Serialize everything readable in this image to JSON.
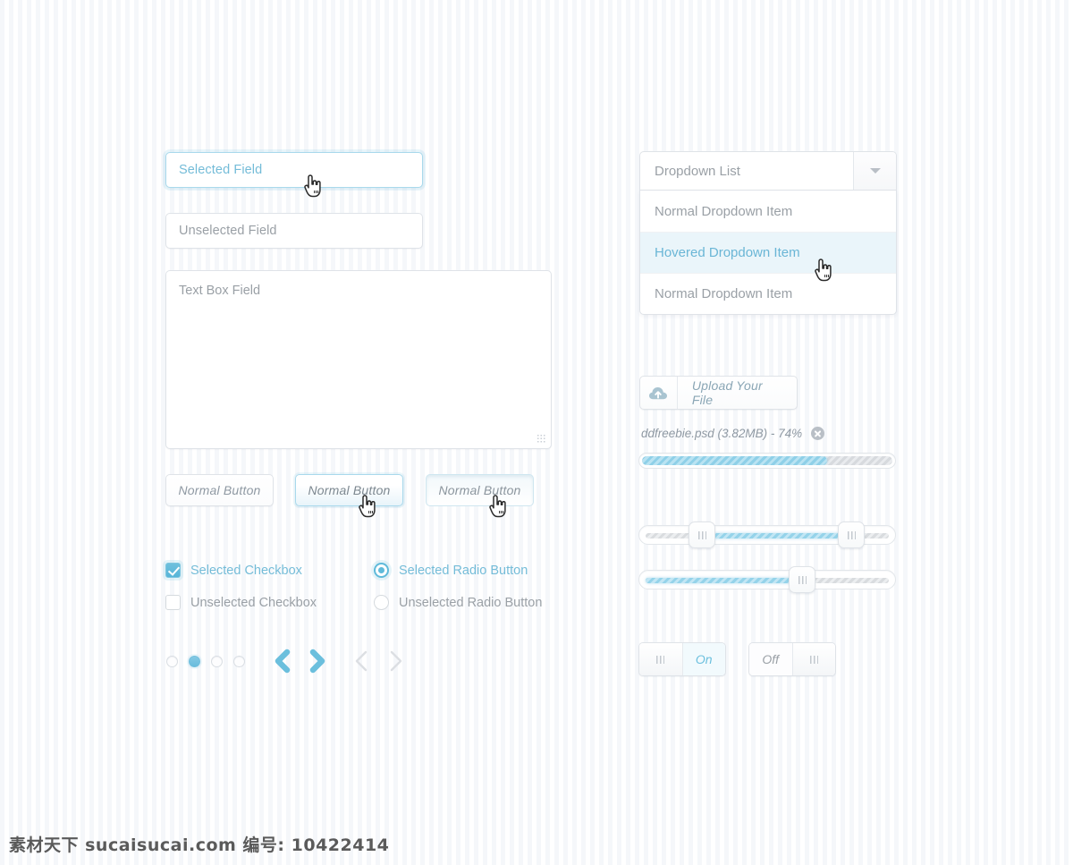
{
  "theme": {
    "accent": "#6cb7d4",
    "accent_fill": "#68bcdd",
    "muted_text": "#9aa0a6",
    "border": "#dfe3e8",
    "hover_bg": "#eaf5fa",
    "page_bg": "#ffffff",
    "stripe": "#f5f7fa"
  },
  "fields": {
    "selected": {
      "label": "Selected Field",
      "state": "selected"
    },
    "unselected": {
      "label": "Unselected Field",
      "state": "normal"
    },
    "textbox": {
      "label": "Text Box Field",
      "resize_icon": "resize-grip-icon"
    }
  },
  "buttons": [
    {
      "label": "Normal Button",
      "state": "normal"
    },
    {
      "label": "Normal Button",
      "state": "hovered"
    },
    {
      "label": "Normal Button",
      "state": "pressed"
    }
  ],
  "checkboxes": [
    {
      "label": "Selected Checkbox",
      "checked": true
    },
    {
      "label": "Unselected Checkbox",
      "checked": false
    }
  ],
  "radios": [
    {
      "label": "Selected Radio Button",
      "checked": true
    },
    {
      "label": "Unselected Radio Button",
      "checked": false
    }
  ],
  "pagination": {
    "dots": [
      {
        "active": false
      },
      {
        "active": true
      },
      {
        "active": false
      },
      {
        "active": false
      }
    ],
    "arrows": [
      {
        "icon": "chevron-left-icon",
        "state": "active"
      },
      {
        "icon": "chevron-right-icon",
        "state": "active"
      },
      {
        "icon": "chevron-left-icon",
        "state": "disabled"
      },
      {
        "icon": "chevron-right-icon",
        "state": "disabled"
      }
    ]
  },
  "dropdown": {
    "value": "Dropdown List",
    "arrow_icon": "chevron-down-icon",
    "items": [
      {
        "label": "Normal Dropdown Item",
        "state": "normal"
      },
      {
        "label": "Hovered Dropdown Item",
        "state": "hovered"
      },
      {
        "label": "Normal Dropdown Item",
        "state": "normal"
      }
    ]
  },
  "upload": {
    "icon": "cloud-upload-icon",
    "button_label": "Upload Your File",
    "file_status": "ddfreebie.psd (3.82MB) - 74%",
    "remove_icon": "close-circle-icon",
    "progress_percent": 74
  },
  "sliders": [
    {
      "type": "range",
      "start_percent": 23,
      "end_percent": 84,
      "grip_icon": "grip-icon"
    },
    {
      "type": "single",
      "value_percent": 64,
      "grip_icon": "grip-icon"
    }
  ],
  "toggles": [
    {
      "label": "On",
      "state": "on",
      "grip_icon": "grip-icon"
    },
    {
      "label": "Off",
      "state": "off",
      "grip_icon": "grip-icon"
    }
  ],
  "cursors": [
    {
      "icon": "pointer-hand-cursor",
      "target": "selected-field"
    },
    {
      "icon": "pointer-hand-cursor",
      "target": "hovered-button"
    },
    {
      "icon": "pointer-hand-cursor",
      "target": "pressed-button"
    },
    {
      "icon": "pointer-hand-cursor",
      "target": "hovered-dropdown-item"
    }
  ],
  "watermark": {
    "text": "素材天下 sucaisucai.com  编号: 10422414"
  }
}
